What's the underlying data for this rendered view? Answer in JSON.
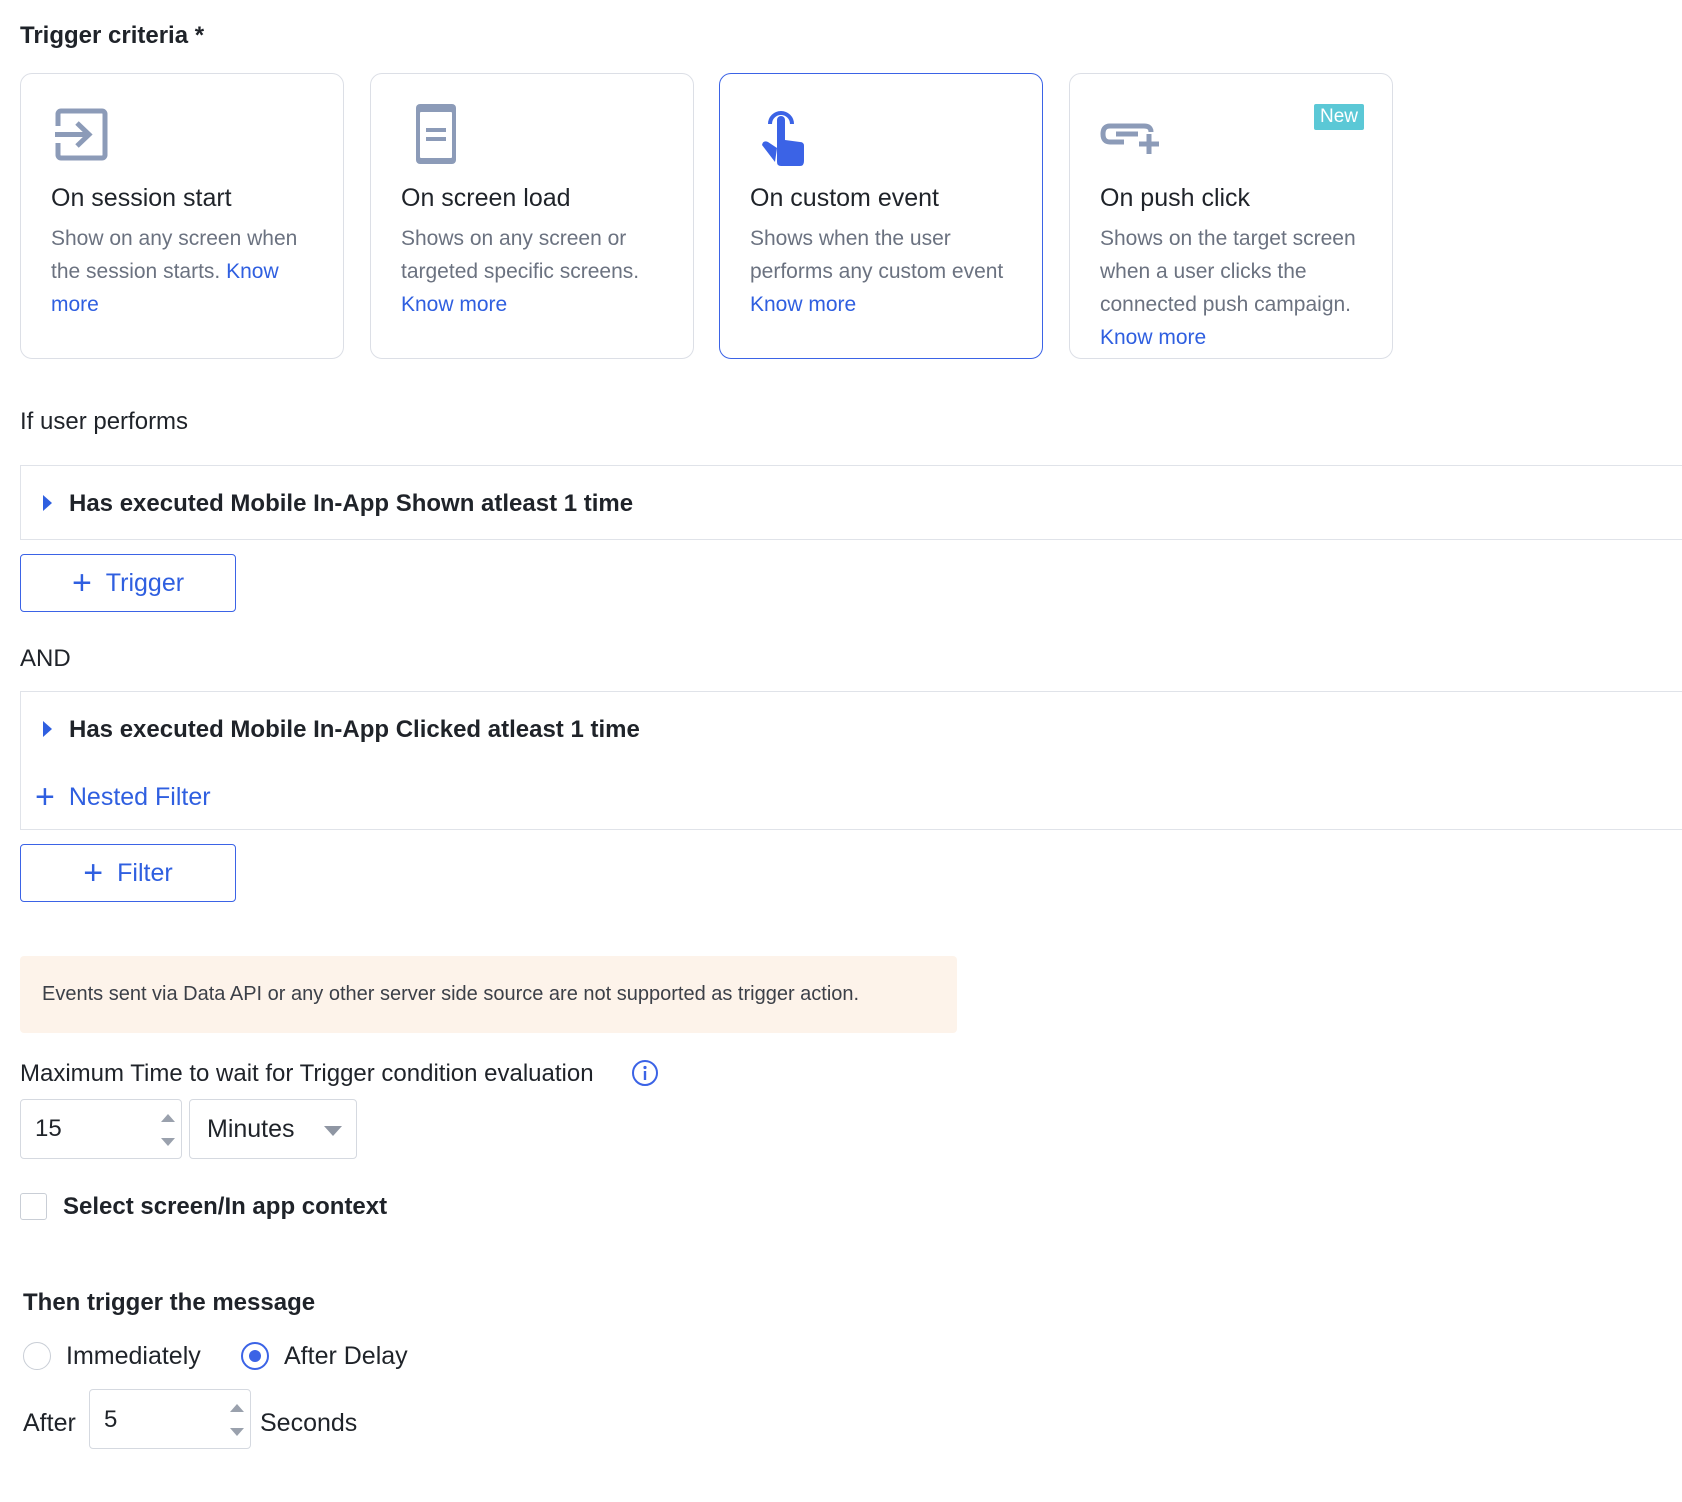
{
  "trigger_criteria": {
    "title": "Trigger criteria *",
    "cards": [
      {
        "icon": "session-enter-icon",
        "title": "On session start",
        "desc": "Show on any screen when the session starts.",
        "link": "Know more",
        "selected": false
      },
      {
        "icon": "screen-page-icon",
        "title": "On screen load",
        "desc": "Shows on any screen or targeted specific screens.",
        "link": "Know more",
        "selected": false
      },
      {
        "icon": "tap-hand-icon",
        "title": "On custom event",
        "desc": "Shows when the user performs any custom event",
        "link": "Know more",
        "selected": true
      },
      {
        "icon": "push-link-icon",
        "title": "On push click",
        "desc": "Shows on the target screen when a user clicks the connected push campaign.",
        "link": "Know more",
        "badge": "New",
        "selected": false
      }
    ]
  },
  "if_user_performs": {
    "label": "If user performs",
    "trigger_filter": "Has executed Mobile In-App Shown atleast 1 time",
    "add_trigger_label": "Trigger"
  },
  "and_block": {
    "label": "AND",
    "filter": "Has executed Mobile In-App Clicked atleast 1 time",
    "nested_filter_label": "Nested Filter",
    "add_filter_label": "Filter"
  },
  "notice": {
    "text": "Events sent via Data API or any other server side source are not supported as trigger action.",
    "bg_color": "#fdf3ea"
  },
  "max_wait": {
    "label": "Maximum Time to wait for Trigger condition evaluation",
    "value": "15",
    "unit": "Minutes"
  },
  "context": {
    "label": "Select screen/In app context",
    "checked": false
  },
  "then_trigger": {
    "title": "Then trigger the message",
    "option_immediately": "Immediately",
    "option_after_delay": "After Delay",
    "selected": "After Delay",
    "after_label": "After",
    "delay_value": "5",
    "delay_unit": "Seconds"
  },
  "colors": {
    "accent": "#3b63e6",
    "link": "#2f5fe0",
    "badge": "#5bc8d6",
    "icon_gray": "#8c9bb8"
  }
}
